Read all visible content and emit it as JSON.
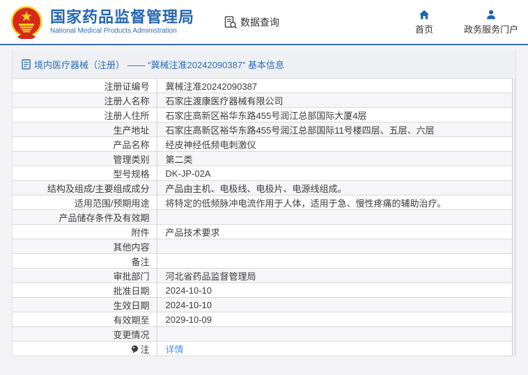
{
  "header": {
    "title": "国家药品监督管理局",
    "subtitle": "National Medical Products Administration",
    "data_query_label": "数据查询",
    "nav": [
      {
        "label": "首页",
        "icon": "home-icon"
      },
      {
        "label": "政务服务门户",
        "icon": "user-icon"
      }
    ]
  },
  "breadcrumb": {
    "text": "境内医疗器械（注册） —— “冀械注准20242090387” 基本信息"
  },
  "table": {
    "rows": [
      {
        "label": "注册证编号",
        "value": "冀械注准20242090387"
      },
      {
        "label": "注册人名称",
        "value": "石家庄渡康医疗器械有限公司"
      },
      {
        "label": "注册人住所",
        "value": "石家庄高新区裕华东路455号润江总部国际大厦4层"
      },
      {
        "label": "生产地址",
        "value": "石家庄高新区裕华东路455号润江总部国际11号楼四层、五层、六层"
      },
      {
        "label": "产品名称",
        "value": "经皮神经低频电刺激仪"
      },
      {
        "label": "管理类别",
        "value": "第二类"
      },
      {
        "label": "型号规格",
        "value": "DK-JP-02A"
      },
      {
        "label": "结构及组成/主要组成成分",
        "value": "产品由主机、电极线、电极片、电源线组成。"
      },
      {
        "label": "适用范围/预期用途",
        "value": "将特定的低频脉冲电流作用于人体，适用于急、慢性疼痛的辅助治疗。"
      },
      {
        "label": "产品储存条件及有效期",
        "value": ""
      },
      {
        "label": "附件",
        "value": "产品技术要求"
      },
      {
        "label": "其他内容",
        "value": ""
      },
      {
        "label": "备注",
        "value": ""
      },
      {
        "label": "审批部门",
        "value": "河北省药品监督管理局"
      },
      {
        "label": "批准日期",
        "value": "2024-10-10"
      },
      {
        "label": "生效日期",
        "value": "2024-10-10"
      },
      {
        "label": "有效期至",
        "value": "2029-10-09"
      },
      {
        "label": "变更情况",
        "value": ""
      },
      {
        "label": "注",
        "value": "详情"
      }
    ]
  },
  "colors": {
    "accent_blue": "#2667b1",
    "line_blue": "#3a6db3",
    "breadcrumb_blue": "#2e6db4",
    "link_blue": "#4a90d9",
    "stripe_gray": "#f6f6f8",
    "emblem_red": "#d7281e",
    "emblem_gold": "#f7d117"
  }
}
